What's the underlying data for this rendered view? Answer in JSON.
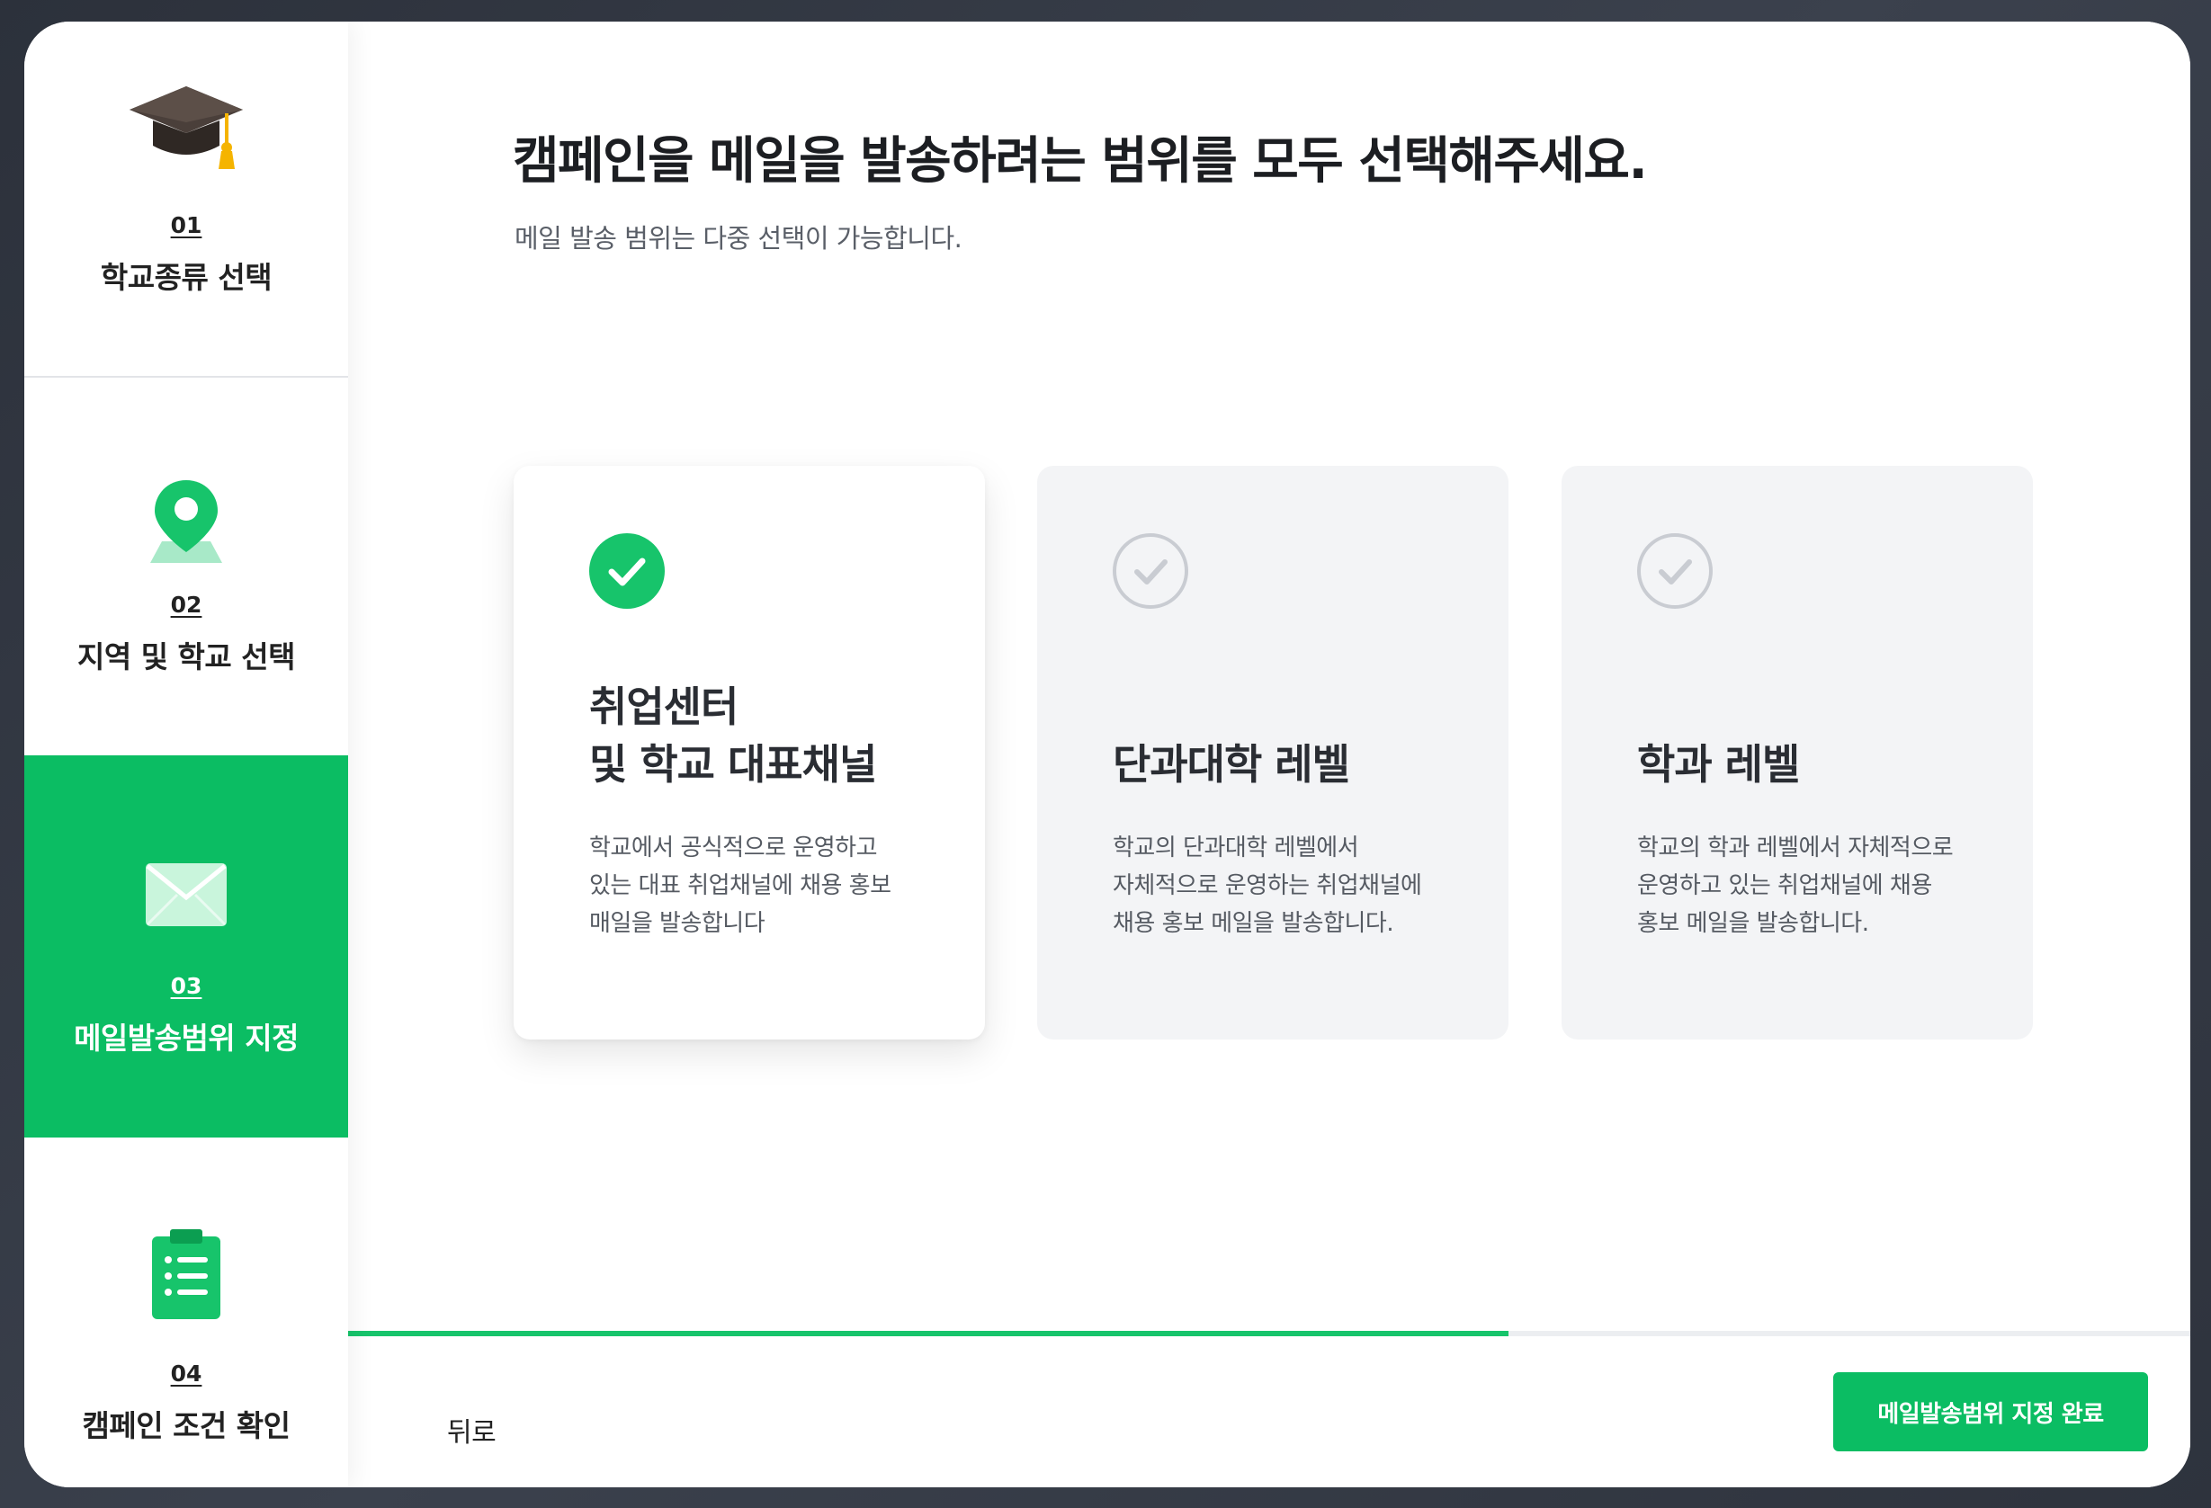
{
  "sidebar": {
    "steps": [
      {
        "num": "01",
        "label": "학교종류 선택",
        "icon": "graduation-cap-icon"
      },
      {
        "num": "02",
        "label": "지역 및 학교 선택",
        "icon": "map-pin-icon"
      },
      {
        "num": "03",
        "label": "메일발송범위 지정",
        "icon": "envelope-icon"
      },
      {
        "num": "04",
        "label": "캠페인 조건 확인",
        "icon": "clipboard-list-icon"
      }
    ],
    "active_step": "03"
  },
  "main": {
    "title": "캠페인을 메일을 발송하려는 범위를 모두 선택해주세요.",
    "subtitle": "메일 발송 범위는 다중 선택이 가능합니다.",
    "cards": [
      {
        "title_lines": [
          "취업센터",
          "및 학교 대표채널"
        ],
        "desc_lines": [
          "학교에서 공식적으로 운영하고",
          "있는 대표 취업채널에 채용 홍보",
          "매일을 발송합니다"
        ],
        "selected": true
      },
      {
        "title_lines": [
          "단과대학 레벨"
        ],
        "desc_lines": [
          "학교의 단과대학 레벨에서",
          "자체적으로 운영하는 취업채널에",
          "채용 홍보 메일을 발송합니다."
        ],
        "selected": false
      },
      {
        "title_lines": [
          "학과 레벨"
        ],
        "desc_lines": [
          "학교의 학과 레벨에서 자체적으로",
          "운영하고 있는 취업채널에 채용",
          "홍보 메일을 발송합니다."
        ],
        "selected": false
      }
    ]
  },
  "footer": {
    "back_label": "뒤로",
    "done_label": "메일발송범위 지정 완료",
    "progress_percent": 63
  },
  "colors": {
    "accent": "#0bbd63",
    "check_selected": "#17c46b",
    "check_unselected": "#c9ccd2",
    "card_unselected_bg": "#f3f4f6"
  }
}
